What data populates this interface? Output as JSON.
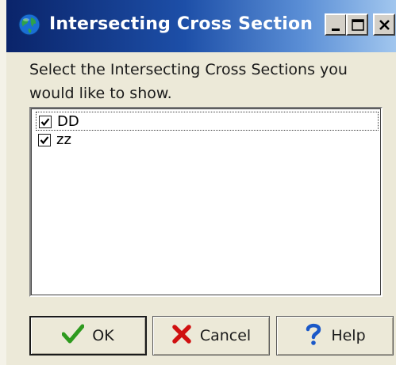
{
  "window": {
    "title": "Intersecting Cross Section",
    "title_icon": "globe-icon"
  },
  "titlebar_buttons": {
    "minimize": "minimize-icon",
    "maximize": "maximize-icon",
    "close": "close-icon"
  },
  "instruction": "Select the Intersecting Cross Sections you would like to show.",
  "sections": [
    {
      "label": "DD",
      "checked": true,
      "focused": true
    },
    {
      "label": "zz",
      "checked": true,
      "focused": false
    }
  ],
  "buttons": {
    "ok": {
      "label": "OK",
      "icon": "checkmark-icon",
      "color": "#2e9a1e"
    },
    "cancel": {
      "label": "Cancel",
      "icon": "x-mark-icon",
      "color": "#d01010"
    },
    "help": {
      "label": "Help",
      "icon": "question-mark-icon",
      "color": "#1a58c8"
    }
  },
  "colors": {
    "titlebar_start": "#0a246a",
    "titlebar_end": "#a6caf0",
    "dialog_bg": "#ece9d8"
  }
}
